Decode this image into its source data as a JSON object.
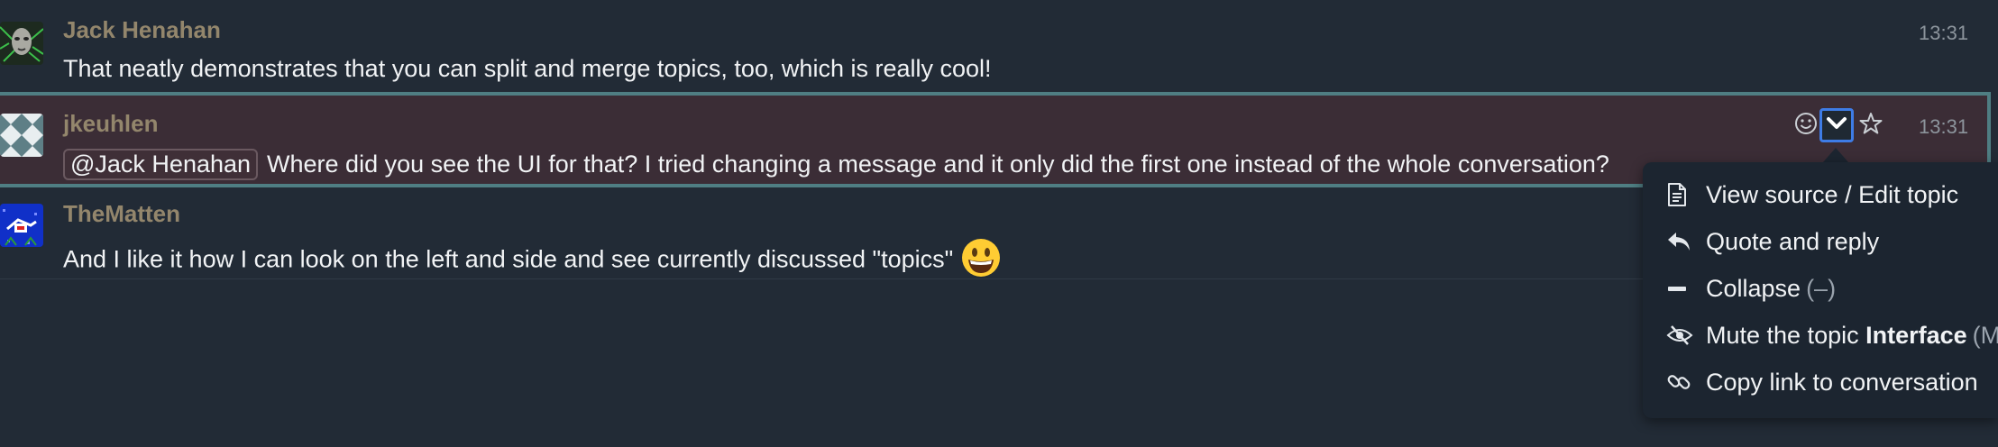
{
  "messages": [
    {
      "sender": "Jack Henahan",
      "time": "13:31",
      "text": "That neatly demonstrates that you can split and merge topics, too, which is really cool!"
    },
    {
      "sender": "jkeuhlen",
      "time": "13:31",
      "mention": "@Jack Henahan",
      "text": "Where did you see the UI for that? I tried changing a message and it only did the first one instead of the whole conversation?"
    },
    {
      "sender": "TheMatten",
      "text": "And I like it how I can look on the left and side and see currently discussed \"topics\""
    }
  ],
  "message_actions": {
    "emoji_icon": "smiley-icon",
    "more_icon": "chevron-down-icon",
    "star_icon": "star-icon"
  },
  "menu": {
    "items": [
      {
        "label": "View source / Edit topic",
        "icon": "document-icon"
      },
      {
        "label": "Quote and reply",
        "icon": "reply-icon"
      },
      {
        "label": "Collapse",
        "hint": "(–)",
        "icon": "minus-icon"
      },
      {
        "label_prefix": "Mute the topic",
        "label_topic": "Interface",
        "hint": "(M)",
        "icon": "eye-slash-icon"
      },
      {
        "label": "Copy link to conversation",
        "icon": "link-icon"
      }
    ]
  },
  "colors": {
    "background": "#222b36",
    "selected_background": "#3b2d36",
    "selected_border": "#4f7e83",
    "sender": "#93866c",
    "focus_ring": "#3e7ce6"
  }
}
